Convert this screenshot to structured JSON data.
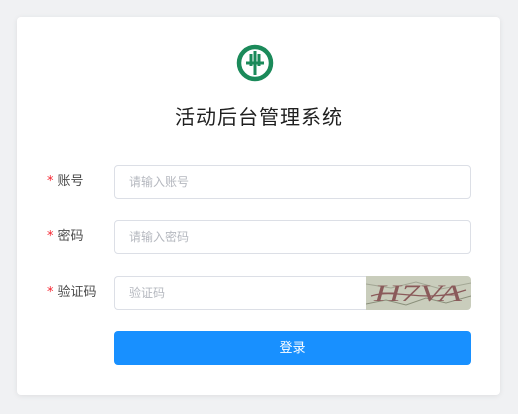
{
  "header": {
    "title": "活动后台管理系统",
    "logo_icon": "abc-bank-logo-icon",
    "logo_color": "#1b8a5a"
  },
  "form": {
    "account": {
      "label": "账号",
      "required_mark": "*",
      "placeholder": "请输入账号",
      "value": ""
    },
    "password": {
      "label": "密码",
      "required_mark": "*",
      "placeholder": "请输入密码",
      "value": ""
    },
    "captcha": {
      "label": "验证码",
      "required_mark": "*",
      "placeholder": "验证码",
      "value": "",
      "image_text": "H7VA"
    },
    "submit_label": "登录"
  },
  "colors": {
    "primary": "#1890ff",
    "required": "#f5222d"
  }
}
